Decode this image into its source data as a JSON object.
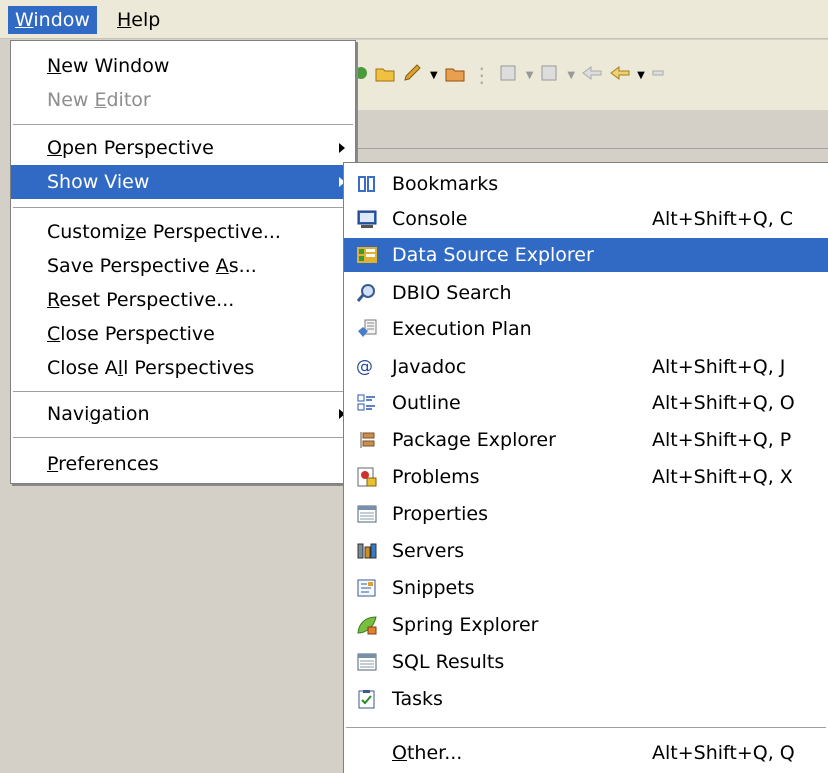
{
  "menubar": {
    "items": [
      {
        "pre": "",
        "mn": "W",
        "post": "indow"
      },
      {
        "pre": "",
        "mn": "H",
        "post": "elp"
      }
    ]
  },
  "window_menu": {
    "items": [
      {
        "pre": "",
        "mn": "N",
        "post": "ew Window",
        "state": "enabled"
      },
      {
        "pre": "New ",
        "mn": "E",
        "post": "ditor",
        "state": "disabled"
      },
      {
        "pre": "",
        "mn": "O",
        "post": "pen Perspective",
        "submenu": true
      },
      {
        "pre": "Show View",
        "mn": "",
        "post": "",
        "submenu": true,
        "state": "highlighted"
      },
      {
        "pre": "Customi",
        "mn": "z",
        "post": "e Perspective..."
      },
      {
        "pre": "Save Perspective ",
        "mn": "A",
        "post": "s..."
      },
      {
        "pre": "",
        "mn": "R",
        "post": "eset Perspective..."
      },
      {
        "pre": "",
        "mn": "C",
        "post": "lose Perspective"
      },
      {
        "pre": "Close A",
        "mn": "l",
        "post": "l Perspectives"
      },
      {
        "pre": "Navi",
        "mn": "g",
        "post": "ation",
        "submenu": true
      },
      {
        "pre": "",
        "mn": "P",
        "post": "references"
      }
    ]
  },
  "show_view_menu": {
    "items": [
      {
        "label": "Bookmarks",
        "icon": "bookmarks-icon",
        "accel": ""
      },
      {
        "label": "Console",
        "icon": "console-icon",
        "accel": "Alt+Shift+Q, C"
      },
      {
        "label": "Data Source Explorer",
        "icon": "data-source-explorer-icon",
        "accel": "",
        "state": "highlighted"
      },
      {
        "label": "DBIO Search",
        "icon": "search-icon",
        "accel": ""
      },
      {
        "label": "Execution Plan",
        "icon": "execution-plan-icon",
        "accel": ""
      },
      {
        "label": "Javadoc",
        "icon": "javadoc-at-icon",
        "accel": "Alt+Shift+Q, J"
      },
      {
        "label": "Outline",
        "icon": "outline-icon",
        "accel": "Alt+Shift+Q, O"
      },
      {
        "label": "Package Explorer",
        "icon": "package-explorer-icon",
        "accel": "Alt+Shift+Q, P"
      },
      {
        "label": "Problems",
        "icon": "problems-icon",
        "accel": "Alt+Shift+Q, X"
      },
      {
        "label": "Properties",
        "icon": "properties-icon",
        "accel": ""
      },
      {
        "label": "Servers",
        "icon": "servers-icon",
        "accel": ""
      },
      {
        "label": "Snippets",
        "icon": "snippets-icon",
        "accel": ""
      },
      {
        "label": "Spring Explorer",
        "icon": "spring-leaf-icon",
        "accel": ""
      },
      {
        "label": "SQL Results",
        "icon": "sql-results-icon",
        "accel": ""
      },
      {
        "label": "Tasks",
        "icon": "tasks-icon",
        "accel": ""
      },
      {
        "pre": "",
        "mn": "O",
        "post": "ther...",
        "accel": "Alt+Shift+Q, Q"
      }
    ]
  },
  "colors": {
    "highlight": "#316ac5",
    "menu_bg": "#ffffff",
    "menubar_bg": "#ece9d8"
  }
}
